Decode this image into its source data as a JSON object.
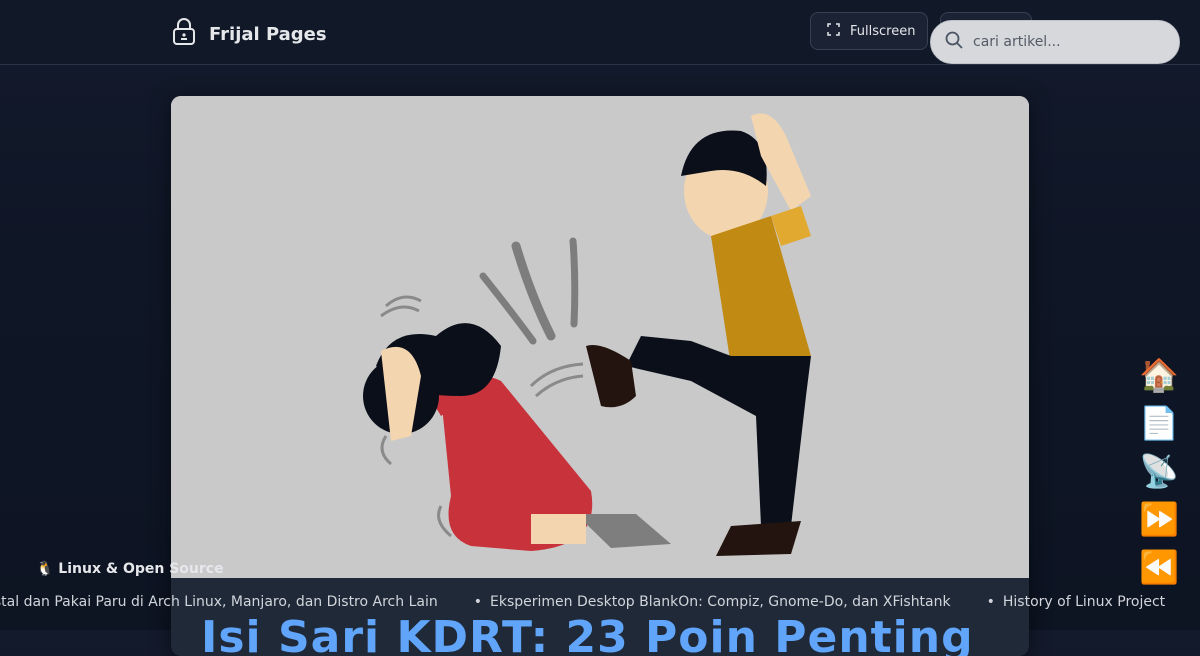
{
  "header": {
    "site_name": "Frijal Pages",
    "fullscreen_label": "Fullscreen",
    "search_placeholder": "cari artikel..."
  },
  "article": {
    "title": "Isi Sari KDRT: 23 Poin Penting"
  },
  "ticker": {
    "heading": "🐧 Linux & Open Source",
    "items": [
      "nstal dan Pakai Paru di Arch Linux, Manjaro, dan Distro Arch Lain",
      "Eksperimen Desktop BlankOn: Compiz, Gnome-Do, dan XFishtank",
      "History of Linux Project"
    ]
  },
  "sidenav": [
    {
      "icon": "house-icon",
      "glyph": "🏠"
    },
    {
      "icon": "document-icon",
      "glyph": "📄"
    },
    {
      "icon": "satellite-dish-icon",
      "glyph": "📡"
    },
    {
      "icon": "fast-forward-icon",
      "glyph": "⏩"
    },
    {
      "icon": "rewind-icon",
      "glyph": "⏪"
    }
  ],
  "colors": {
    "background": "#0f1626",
    "accent": "#60a5fa",
    "search_bg": "#d6d8dc"
  }
}
